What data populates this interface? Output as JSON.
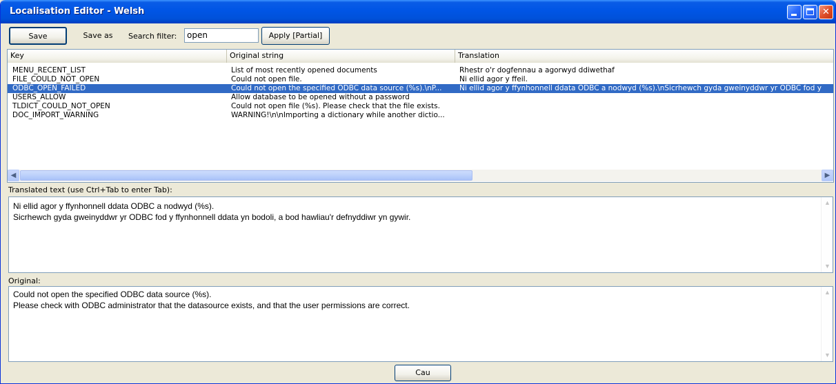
{
  "window": {
    "title": "Localisation Editor - Welsh",
    "minimize_glyph": "",
    "close_glyph": "✕"
  },
  "toolbar": {
    "save_label": "Save",
    "save_as_label": "Save as",
    "search_label": "Search filter:",
    "search_value": "open",
    "apply_label": "Apply [Partial]"
  },
  "list": {
    "columns": [
      "Key",
      "Original string",
      "Translation"
    ],
    "rows": [
      {
        "key": "MENU_RECENT_LIST",
        "original": "List of most recently opened documents",
        "translation": "Rhestr o'r dogfennau a agorwyd ddiwethaf",
        "selected": false
      },
      {
        "key": "FILE_COULD_NOT_OPEN",
        "original": "Could not open file.",
        "translation": "Ni ellid agor y ffeil.",
        "selected": false
      },
      {
        "key": "ODBC_OPEN_FAILED",
        "original": "Could not open the specified ODBC data source (%s).\\nP...",
        "translation": "Ni ellid agor y ffynhonnell ddata ODBC a nodwyd (%s).\\nSicrhewch gyda gweinyddwr yr ODBC fod y",
        "selected": true
      },
      {
        "key": "USERS_ALLOW",
        "original": "Allow database to be opened without a password",
        "translation": "",
        "selected": false
      },
      {
        "key": "TLDICT_COULD_NOT_OPEN",
        "original": "Could not open file (%s). Please check that the file exists.",
        "translation": "",
        "selected": false
      },
      {
        "key": "DOC_IMPORT_WARNING",
        "original": "WARNING!\\n\\nImporting a dictionary while another dictio...",
        "translation": "",
        "selected": false
      }
    ]
  },
  "translated": {
    "label": "Translated text (use Ctrl+Tab to enter Tab):",
    "lines": [
      "Ni ellid agor y ffynhonnell ddata ODBC a nodwyd (%s).",
      "Sicrhewch gyda gweinyddwr yr ODBC fod y ffynhonnell ddata yn bodoli, a bod hawliau'r defnyddiwr yn gywir."
    ]
  },
  "original": {
    "label": "Original:",
    "lines": [
      "Could not open the specified ODBC data source (%s).",
      "Please check with ODBC administrator that the datasource exists, and that the user permissions are correct."
    ]
  },
  "footer": {
    "close_label": "Cau"
  }
}
